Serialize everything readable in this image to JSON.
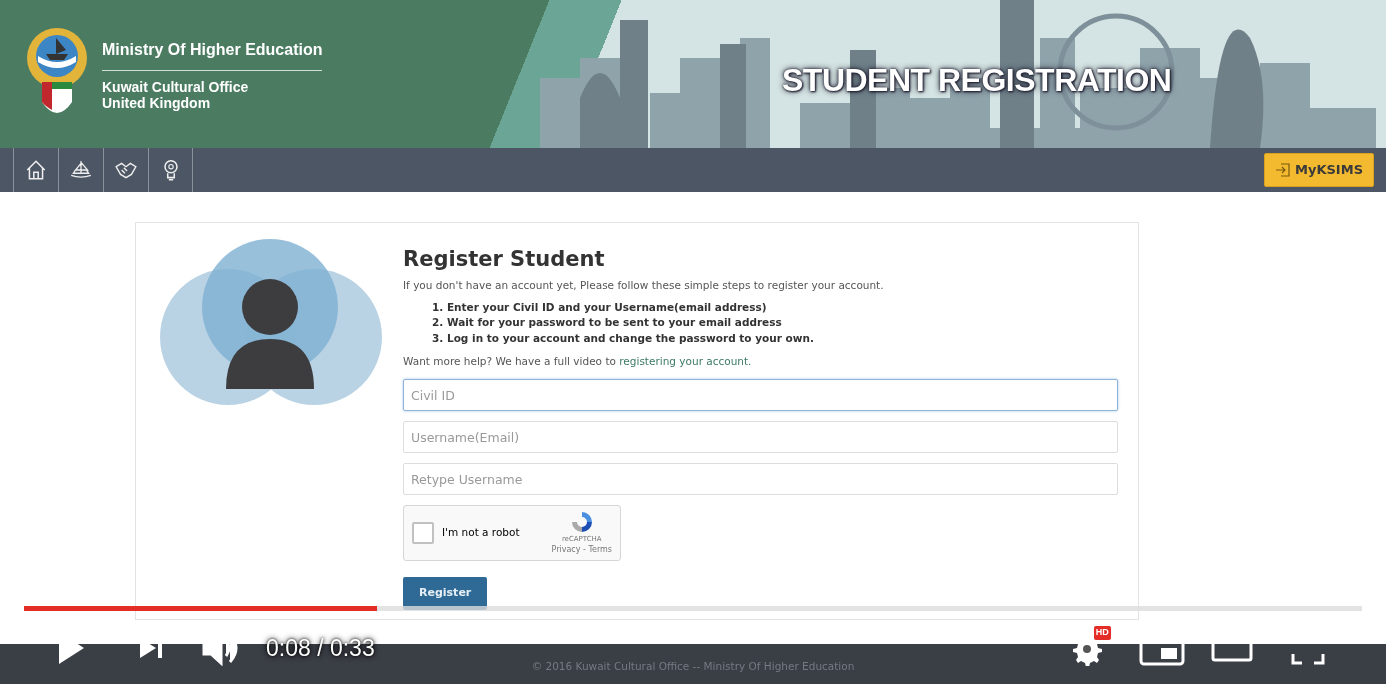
{
  "header": {
    "title": "Ministry Of Higher Education",
    "subtitle_lines": [
      "Kuwait Cultural Office",
      "United Kingdom"
    ],
    "banner_title": "STUDENT REGISTRATION"
  },
  "nav": {
    "button": "MyKSIMS"
  },
  "form": {
    "heading": "Register Student",
    "intro": "If you don't have an account yet, Please follow these simple steps to register your account.",
    "steps": [
      "1. Enter your Civil ID and your Username(email address)",
      "2. Wait for your password to be sent to your email address",
      "3. Log in to your account and change the password to your own."
    ],
    "help_text": "Want more help? We have a full video to",
    "help_link": "registering your account.",
    "fields": [
      {
        "placeholder": "Civil ID",
        "focused": true
      },
      {
        "placeholder": "Username(Email)",
        "focused": false
      },
      {
        "placeholder": "Retype Username",
        "focused": false
      }
    ],
    "captcha": {
      "label": "I'm not a robot",
      "checked": false,
      "brand": "reCAPTCHA",
      "links": "Privacy - Terms"
    },
    "button": "Register"
  },
  "footer": "© 2016 Kuwait Cultural Office -- Ministry Of Higher Education",
  "player": {
    "level": 0.264,
    "time": "0:08 / 0:33",
    "hd_badge": "HD"
  }
}
